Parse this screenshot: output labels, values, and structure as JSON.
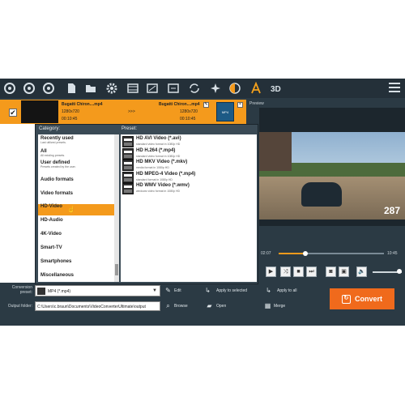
{
  "file_row": {
    "src_name": "Bugatti Chiron....mp4",
    "src_res": "1280x720",
    "src_time": "00:10:45",
    "arrow": ">>>",
    "dst_name": "Bugatti Chiron....mp4",
    "dst_res": "1280x720",
    "dst_time": "00:10:45",
    "badge": "MP4"
  },
  "popup": {
    "category_label": "Category:",
    "preset_label": "Preset:",
    "categories": [
      {
        "name": "Recently used",
        "sub": "Last utilized presets."
      },
      {
        "name": "All",
        "sub": "All existing presets."
      },
      {
        "name": "User defined",
        "sub": "Presets created by the user."
      },
      {
        "name": "Audio formats",
        "sub": ""
      },
      {
        "name": "Video formats",
        "sub": ""
      },
      {
        "name": "HD-Video",
        "sub": ""
      },
      {
        "name": "HD-Audio",
        "sub": ""
      },
      {
        "name": "4K-Video",
        "sub": ""
      },
      {
        "name": "Smart-TV",
        "sub": ""
      },
      {
        "name": "Smartphones",
        "sub": ""
      },
      {
        "name": "Miscellaneous",
        "sub": ""
      }
    ],
    "presets": [
      {
        "name": "HD AVI Video (*.avi)",
        "desc": "standard video format in 1080p HD"
      },
      {
        "name": "HD H.264 (*.mp4)",
        "desc": "standard video format in 1080p HD"
      },
      {
        "name": "HD MKV Video (*.mkv)",
        "desc": "media format in 1080p HD"
      },
      {
        "name": "HD MPEG-4 Video (*.mp4)",
        "desc": "standard format in 1080p HD"
      },
      {
        "name": "HD WMV Video (*.wmv)",
        "desc": "windows video format in 1080p HD"
      }
    ]
  },
  "preview": {
    "label": "Preview",
    "hud": "287",
    "time_current": "02:07",
    "time_total": "10:45",
    "progress": 0.25
  },
  "bottom": {
    "conversion_label": "Conversion preset:",
    "preset_value": "MP4 (*.mp4)",
    "output_label": "Output folder:",
    "output_path": "C:\\Users\\c.braun\\Documents\\VideoConverterUltimate\\output",
    "edit": "Edit",
    "apply_selected": "Apply to selected",
    "apply_all": "Apply to all",
    "browse": "Browse",
    "open": "Open",
    "merge": "Merge",
    "convert": "Convert"
  },
  "colors": {
    "accent": "#f49a1c",
    "convert": "#f06a1c",
    "background": "#2b3a44"
  }
}
